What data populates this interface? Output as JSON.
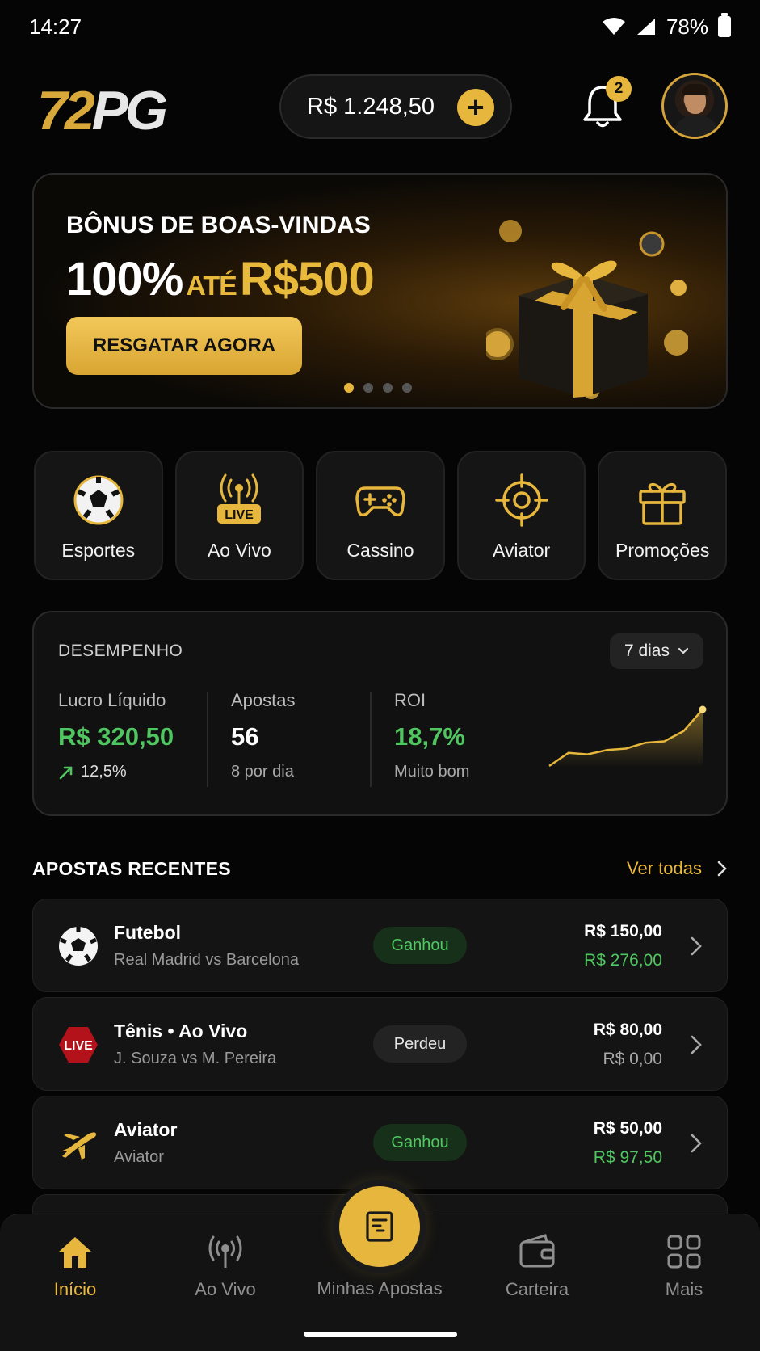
{
  "status": {
    "time": "14:27",
    "battery": "78%"
  },
  "header": {
    "logo_num": "72",
    "logo_pg": "PG",
    "balance": "R$ 1.248,50",
    "notifications_count": "2"
  },
  "banner": {
    "title": "BÔNUS DE BOAS-VINDAS",
    "offer_pct": "100%",
    "offer_ate": "ATÉ",
    "offer_amount": "R$500",
    "cta": "RESGATAR AGORA",
    "slides": 4,
    "active_slide": 1
  },
  "categories": [
    {
      "label": "Esportes",
      "icon": "soccer-ball-icon"
    },
    {
      "label": "Ao Vivo",
      "icon": "live-broadcast-icon",
      "badge": "LIVE"
    },
    {
      "label": "Cassino",
      "icon": "gamepad-icon"
    },
    {
      "label": "Aviator",
      "icon": "crosshair-icon"
    },
    {
      "label": "Promoções",
      "icon": "gift-icon"
    }
  ],
  "performance": {
    "title": "DESEMPENHO",
    "period": "7 dias",
    "profit_label": "Lucro Líquido",
    "profit_value": "R$ 320,50",
    "profit_change": "12,5%",
    "bets_label": "Apostas",
    "bets_value": "56",
    "bets_sub": "8 por dia",
    "roi_label": "ROI",
    "roi_value": "18,7%",
    "roi_sub": "Muito bom",
    "trend": [
      2,
      20,
      18,
      24,
      26,
      34,
      36,
      50,
      80
    ]
  },
  "recent": {
    "title": "APOSTAS RECENTES",
    "see_all": "Ver todas",
    "bets": [
      {
        "name": "Futebol",
        "match": "Real Madrid vs Barcelona",
        "status": "Ganhou",
        "stake": "R$ 150,00",
        "payout": "R$ 276,00",
        "icon": "soccer-ball-icon"
      },
      {
        "name": "Tênis • Ao Vivo",
        "match": "J. Souza vs M. Pereira",
        "status": "Perdeu",
        "stake": "R$ 80,00",
        "payout": "R$ 0,00",
        "icon": "live-badge-icon",
        "icon_text": "LIVE"
      },
      {
        "name": "Aviator",
        "match": "Aviator",
        "status": "Ganhou",
        "stake": "R$ 50,00",
        "payout": "R$ 97,50",
        "icon": "airplane-icon"
      }
    ]
  },
  "nav": {
    "home": "Início",
    "live": "Ao Vivo",
    "my_bets": "Minhas Apostas",
    "wallet": "Carteira",
    "more": "Mais"
  },
  "colors": {
    "accent": "#e6b73c",
    "positive": "#4fc65f",
    "background": "#050505"
  }
}
